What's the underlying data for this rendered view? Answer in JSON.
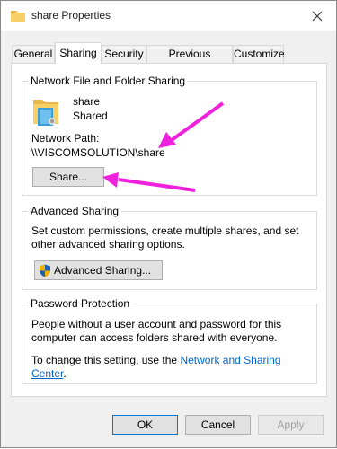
{
  "window": {
    "title": "share Properties"
  },
  "tabs": [
    {
      "label": "General"
    },
    {
      "label": "Sharing"
    },
    {
      "label": "Security"
    },
    {
      "label": "Previous Versions"
    },
    {
      "label": "Customize"
    }
  ],
  "network_sharing": {
    "legend": "Network File and Folder Sharing",
    "folder_name": "share",
    "folder_status": "Shared",
    "path_label": "Network Path:",
    "path_value": "\\\\VISCOMSOLUTION\\share",
    "share_button": "Share..."
  },
  "advanced_sharing": {
    "legend": "Advanced Sharing",
    "description": "Set custom permissions, create multiple shares, and set other advanced sharing options.",
    "button": "Advanced Sharing..."
  },
  "password_protection": {
    "legend": "Password Protection",
    "description": "People without a user account and password for this computer can access folders shared with everyone.",
    "change_prefix": "To change this setting, use the ",
    "link": "Network and Sharing Center",
    "change_suffix": "."
  },
  "footer": {
    "ok": "OK",
    "cancel": "Cancel",
    "apply": "Apply"
  },
  "colors": {
    "arrow": "#ee22dd",
    "link": "#0066cc",
    "focus": "#0078d7"
  }
}
